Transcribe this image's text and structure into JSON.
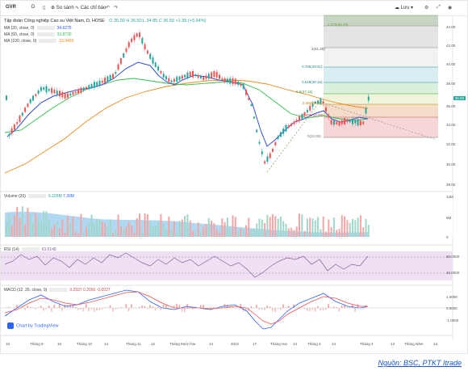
{
  "toolbar": {
    "symbol": "GVR",
    "interval": "D",
    "compare_label": "So sánh",
    "indicators_label": "Các chỉ báo",
    "save_label": "Lưu",
    "undo_icon": "undo-icon",
    "redo_icon": "redo-icon"
  },
  "chart_title": {
    "name": "Tập đoàn Công nghiệp Cao su Việt Nam, D, HOSE",
    "ohlc": "O 35.00  H 36.50  L 34.85  C 36.50  +1.95 (+5.64%)"
  },
  "moving_averages": [
    {
      "label": "MA (20, close, 0)",
      "value": "34.6275",
      "color": "#2e4ed8"
    },
    {
      "label": "MA (50, close, 0)",
      "value": "33.8730",
      "color": "#2fbf4f"
    },
    {
      "label": "MA (100, close, 0)",
      "value": "33.9465",
      "color": "#f08a1c"
    }
  ],
  "fib_labels": [
    {
      "text": "1.272(43.79)",
      "color": "#6a9a3a"
    },
    {
      "text": "1(41.45)",
      "color": "#555555"
    },
    {
      "text": "0.786(39.61)",
      "color": "#2a8a9a"
    },
    {
      "text": "0.618(38.16)",
      "color": "#2a8a9a"
    },
    {
      "text": "0.5(37.15)",
      "color": "#3a9a3a"
    },
    {
      "text": "0.382(36.14)",
      "color": "#c57a0a"
    },
    {
      "text": "0.236(34.88)",
      "color": "#c05050"
    },
    {
      "text": "0(32.85)",
      "color": "#777777"
    }
  ],
  "price_axis": [
    "44.00",
    "42.00",
    "40.00",
    "38.00",
    "36.00",
    "34.00",
    "32.00",
    "30.00",
    "28.00"
  ],
  "last_price": "36.50",
  "volume_pane": {
    "label": "Volume (20)",
    "value1": "6.226M",
    "value2": "7.30M",
    "axis": [
      "12M",
      "6M",
      "0"
    ]
  },
  "rsi_pane": {
    "label": "RSI (14)",
    "value": "63.5148",
    "axis": [
      "60.0000",
      "40.0000"
    ]
  },
  "macd_pane": {
    "label": "MACD (12, 26, close, 9)",
    "values": "0.2937  0.2950  -0.0027",
    "axis": [
      "1.0000",
      "0.0000",
      "-1.0000"
    ]
  },
  "x_axis": [
    "10",
    "Tháng 9",
    "16",
    "Tháng 10",
    "14",
    "Tháng 11",
    "12",
    "Tháng Mười hai",
    "14",
    "2022",
    "17",
    "Tháng Hai",
    "14",
    "Tháng 3",
    "14",
    "Tháng 4",
    "13",
    "Tháng Năm",
    "13"
  ],
  "branding": "Chart by TradingView",
  "source_note": "Nguồn: BSC, PTKT Itrade"
}
